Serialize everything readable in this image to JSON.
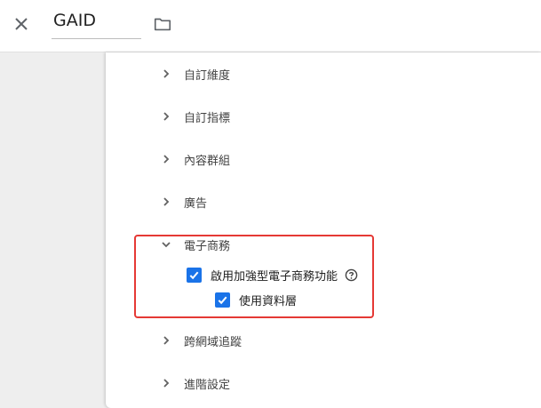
{
  "header": {
    "title": "GAID",
    "close_icon": "close-icon",
    "folder_icon": "folder-icon"
  },
  "sections": [
    {
      "label": "自訂維度",
      "expanded": false
    },
    {
      "label": "自訂指標",
      "expanded": false
    },
    {
      "label": "內容群組",
      "expanded": false
    },
    {
      "label": "廣告",
      "expanded": false
    },
    {
      "label": "電子商務",
      "expanded": true
    },
    {
      "label": "跨網域追蹤",
      "expanded": false
    },
    {
      "label": "進階設定",
      "expanded": false
    }
  ],
  "ecommerce": {
    "enhanced_label": "啟用加強型電子商務功能",
    "enhanced_checked": true,
    "datalayer_label": "使用資料層",
    "datalayer_checked": true,
    "help_icon": "help-icon"
  },
  "colors": {
    "accent": "#1a73e8",
    "highlight": "#e53935",
    "background": "#eeeeee"
  }
}
